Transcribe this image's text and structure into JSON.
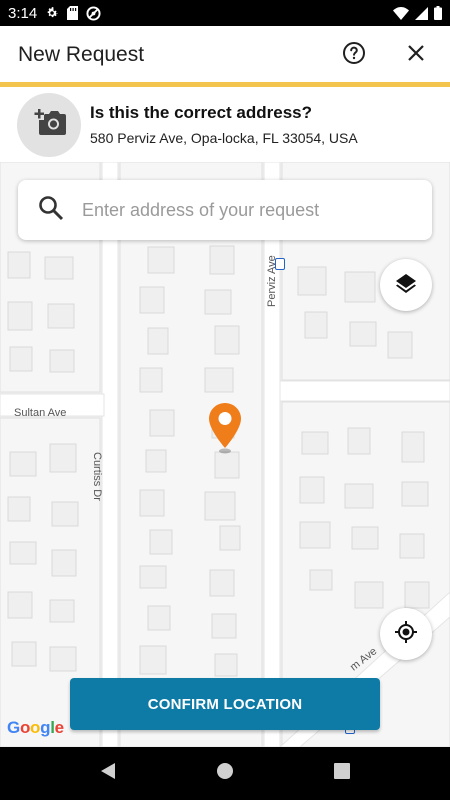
{
  "status_bar": {
    "time": "3:14"
  },
  "app_bar": {
    "title": "New Request"
  },
  "theme": {
    "accent": "#f3c54e",
    "primary": "#0e7ba7",
    "pin": "#ef7d1a"
  },
  "address": {
    "question": "Is this the correct address?",
    "value": "580 Perviz Ave, Opa-locka, FL 33054, USA"
  },
  "search": {
    "placeholder": "Enter address of your request",
    "value": ""
  },
  "map": {
    "streets": [
      "Sultan Ave",
      "Curtiss Dr",
      "Perviz Ave",
      "m Ave"
    ],
    "attribution": "Google"
  },
  "confirm": {
    "label": "CONFIRM LOCATION"
  },
  "icons": {
    "status": [
      "settings-icon",
      "sd-card-icon",
      "do-not-disturb-icon",
      "wifi-icon",
      "signal-icon",
      "battery-icon"
    ],
    "app_bar": [
      "help-icon",
      "close-icon"
    ],
    "banner": "add-photo-icon",
    "search": "search-icon",
    "map": [
      "layers-icon",
      "my-location-icon",
      "map-pin-icon"
    ],
    "nav": [
      "back-icon",
      "home-icon",
      "recents-icon"
    ]
  }
}
